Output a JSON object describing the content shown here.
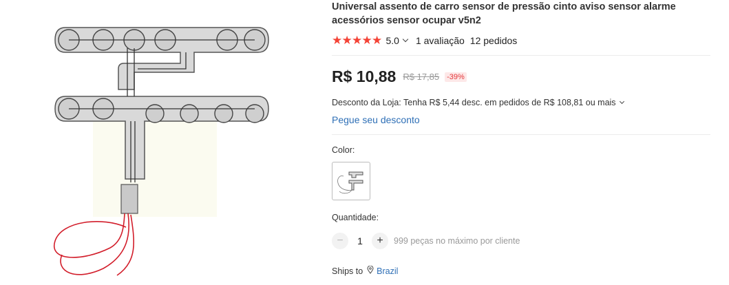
{
  "product": {
    "title": "Universal assento de carro sensor de pressão cinto aviso sensor alarme acessórios sensor ocupar v5n2",
    "image_alt": "car seat pressure sensor pad with red wires"
  },
  "rating": {
    "stars": 5,
    "value": "5.0",
    "reviews": "1 avaliação",
    "orders": "12 pedidos"
  },
  "pricing": {
    "price": "R$ 10,88",
    "old_price": "R$ 17,85",
    "discount": "-39%",
    "store_discount": "Desconto da Loja: Tenha R$ 5,44 desc. em pedidos de R$ 108,81 ou mais",
    "coupon_link": "Pegue seu desconto"
  },
  "options": {
    "color_label": "Color:",
    "swatch_name": "sensor-swatch"
  },
  "quantity": {
    "label": "Quantidade:",
    "value": "1",
    "minus": "−",
    "plus": "+",
    "note": "999 peças no máximo por cliente"
  },
  "shipping": {
    "label": "Ships to",
    "country": "Brazil"
  },
  "colors": {
    "accent_red": "#f44336",
    "link_blue": "#2e6fb6",
    "price_text": "#222222"
  }
}
